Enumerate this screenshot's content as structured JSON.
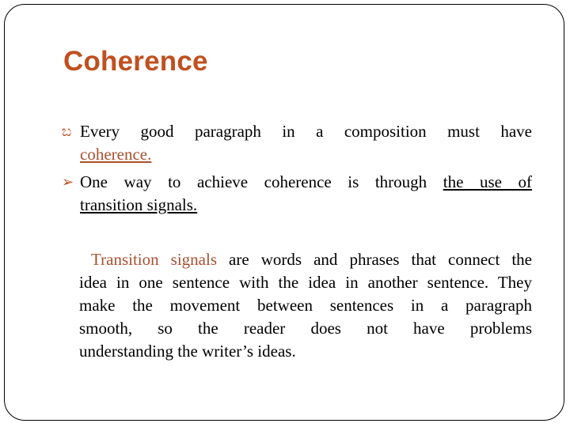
{
  "slide": {
    "title": "Coherence",
    "bullets": [
      {
        "icon": "fancy-scroll-bullet",
        "icon_glyph": "ɛω",
        "line1": "Every good paragraph in a composition must have",
        "line2": "coherence."
      },
      {
        "icon": "arrow-triangle-bullet",
        "icon_glyph": "➢",
        "line1_plain": "One way to achieve coherence is through",
        "line1_underlined": "the use of",
        "line2": "transition signals."
      }
    ],
    "paragraph": {
      "highlight": "Transition signals",
      "lines": [
        " are words and phrases that connect the",
        "idea in one sentence with the idea in another sentence. They",
        "make the movement between sentences in a paragraph",
        "smooth, so the reader does not have problems",
        "understanding the writer’s ideas."
      ]
    },
    "colors": {
      "title": "#c0501f",
      "accent_text": "#a9502f",
      "body_text": "#000000"
    }
  }
}
